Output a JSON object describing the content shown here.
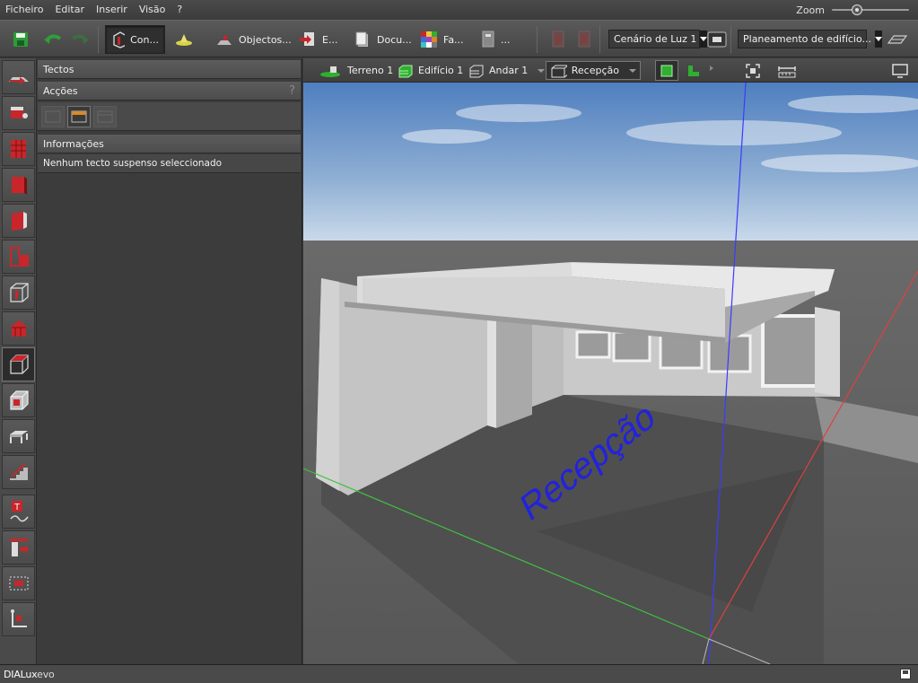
{
  "menu": {
    "items": [
      "Ficheiro",
      "Editar",
      "Inserir",
      "Visão",
      "?"
    ],
    "zoom_label": "Zoom",
    "zoom_level": 0.3
  },
  "toolbar": {
    "save_icon": "save-icon",
    "undo_icon": "undo-icon",
    "redo_icon": "redo-icon",
    "construction_label": "Con...",
    "light_icon": "luminaire-icon",
    "objects_label": "Objectos...",
    "export_label": "E...",
    "documentation_label": "Docu...",
    "colours_label": "Fa...",
    "more_label": "...",
    "light_scene": "Cenário de Luz 1",
    "planning_mode": "Planeamento de edifício...",
    "colors": {
      "accent_red": "#c8262a",
      "accent_green": "#2fb02f",
      "selected_bg": "#2f2f2f"
    }
  },
  "left_tools": [
    "terrain-tool-icon",
    "object-tool-icon",
    "building-tool-icon",
    "wall-tool-icon",
    "door-tool-icon",
    "room-tool-icon",
    "cube-tool-icon",
    "roof-tool-icon",
    "ceiling-tool-icon",
    "box-tool-icon",
    "table-tool-icon",
    "stairs-tool-icon",
    "text-tool-icon",
    "cut-tool-icon",
    "frame-tool-icon",
    "measure-tool-icon"
  ],
  "panel": {
    "title": "Tectos",
    "actions_title": "Acções",
    "help": "?",
    "info_title": "Informações",
    "info_text": "Nenhum tecto suspenso seleccionado"
  },
  "viewport": {
    "breadcrumbs": [
      "Terreno 1",
      "Edifício 1",
      "Andar 1"
    ],
    "room": "Recepção",
    "room_label_3d": "Recepção",
    "axis_colors": {
      "x": "#e04040",
      "y": "#40c040",
      "z": "#3b3bff"
    }
  },
  "status": {
    "app_name_bold": "DIALux",
    "app_name_thin": "evo"
  }
}
